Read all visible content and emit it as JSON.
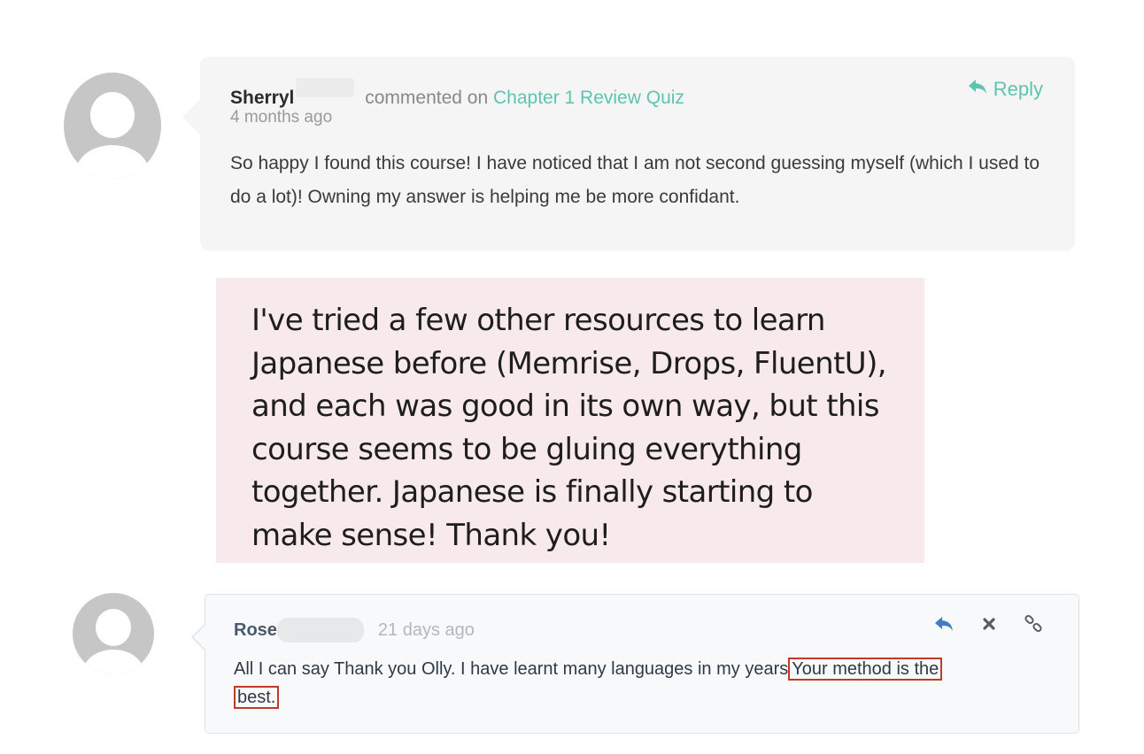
{
  "comment1": {
    "author": "Sherryl",
    "action_text": "commented on",
    "link_text": "Chapter 1 Review Quiz",
    "time": "4 months ago",
    "reply_label": "Reply",
    "body": "So happy I found this course! I have noticed that I am not second guessing myself (which I used to do a lot)! Owning my answer is helping me be more confidant."
  },
  "quote": {
    "text": "I've tried a few other resources to learn Japanese before (Memrise, Drops, FluentU), and each was good in its own way, but this course seems to be gluing everything together. Japanese is finally starting to make sense! Thank you!"
  },
  "comment2": {
    "author": "Rose",
    "time": "21 days ago",
    "body_start": "All I can say Thank you Olly. I have learnt many languages in my years",
    "body_highlight_1": "Your method is the",
    "body_highlight_2": "best."
  },
  "colors": {
    "link_teal": "#5ec4b0",
    "highlight_red": "#c0392b",
    "reply_blue": "#3d7fc1",
    "quote_bg": "#f8eaec"
  },
  "icons": {
    "reply1": "reply-arrow-icon",
    "reply2": "reply-arrow-icon",
    "delete": "close-icon",
    "link": "link-icon"
  }
}
